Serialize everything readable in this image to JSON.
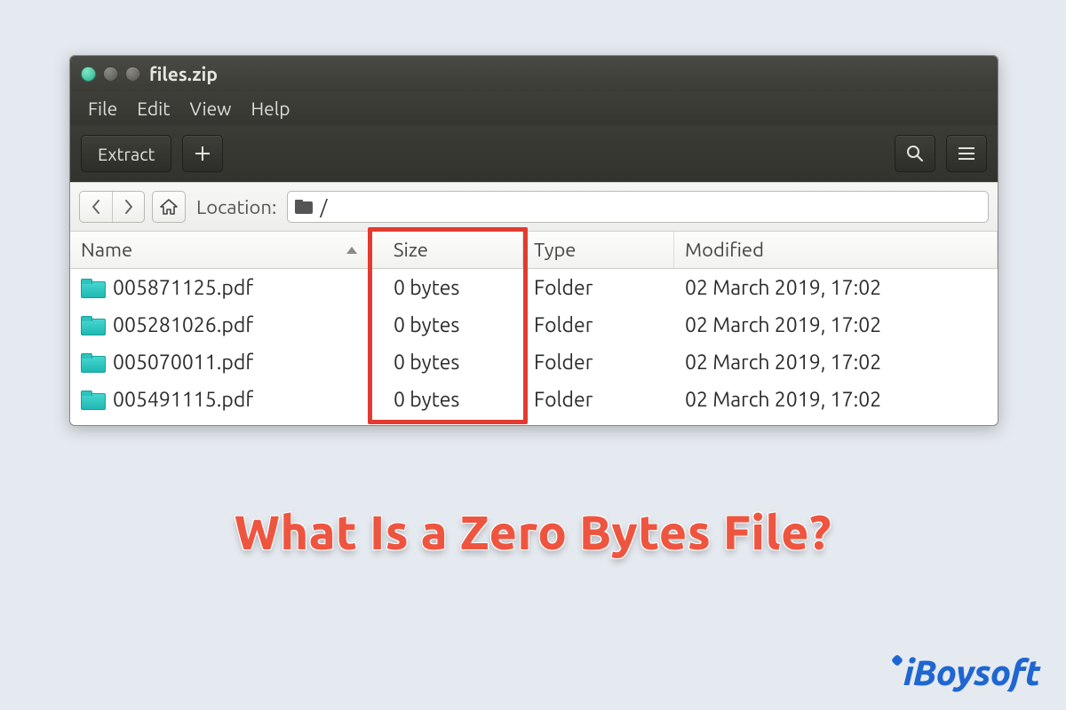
{
  "window": {
    "title": "files.zip"
  },
  "menus": [
    "File",
    "Edit",
    "View",
    "Help"
  ],
  "toolbar": {
    "extract_label": "Extract",
    "add_tooltip": "Add",
    "search_tooltip": "Search",
    "menu_tooltip": "Menu"
  },
  "location": {
    "label": "Location:",
    "path": "/"
  },
  "columns": {
    "name": "Name",
    "size": "Size",
    "type": "Type",
    "modified": "Modified"
  },
  "rows": [
    {
      "name": "005871125.pdf",
      "size": "0 bytes",
      "type": "Folder",
      "modified": "02 March 2019, 17:02"
    },
    {
      "name": "005281026.pdf",
      "size": "0 bytes",
      "type": "Folder",
      "modified": "02 March 2019, 17:02"
    },
    {
      "name": "005070011.pdf",
      "size": "0 bytes",
      "type": "Folder",
      "modified": "02 March 2019, 17:02"
    },
    {
      "name": "005491115.pdf",
      "size": "0 bytes",
      "type": "Folder",
      "modified": "02 March 2019, 17:02"
    }
  ],
  "caption": "What Is a Zero Bytes File?",
  "brand": "iBoysoft",
  "highlight": {
    "column": "size"
  },
  "colors": {
    "accent_red": "#e33b2f",
    "brand_blue": "#1f66d1",
    "folder_teal": "#2ec2bc"
  }
}
